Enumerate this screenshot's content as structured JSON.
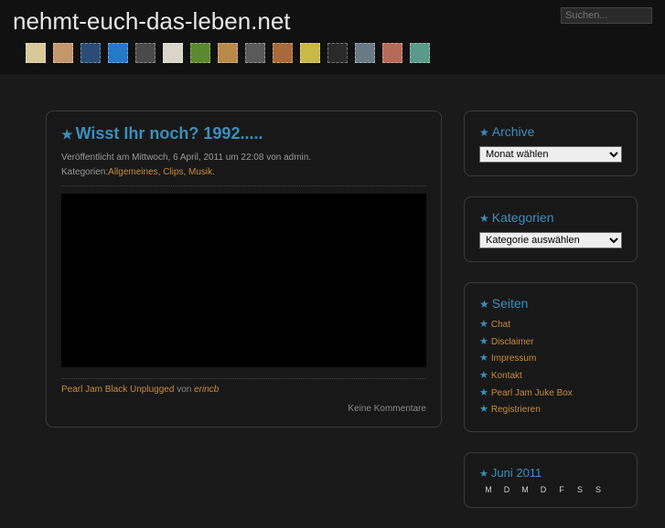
{
  "site": {
    "title": "nehmt-euch-das-leben.net"
  },
  "search": {
    "placeholder": "Suchen..."
  },
  "swatches": [
    "#d9c99a",
    "#c4966b",
    "#2b4d75",
    "#2878c8",
    "#4a4a4a",
    "#d9d5c8",
    "#5a8a2d",
    "#b88a4a",
    "#5a5a5a",
    "#a86a3a",
    "#c9b84a",
    "#2a2a2a",
    "#6a7a85",
    "#b86a5a",
    "#5a9a8a"
  ],
  "post": {
    "title": "Wisst Ihr noch? 1992.....",
    "meta_line": "Veröffentlicht am Mittwoch, 6 April, 2011 um 22:08 von admin.",
    "cat_label": "Kategorien:",
    "cats": [
      "Allgemeines",
      "Clips",
      "Musik"
    ],
    "video_caption_title": "Pearl Jam Black Unplugged",
    "video_caption_by": "von",
    "video_caption_author": "erincb",
    "comments": "Keine Kommentare"
  },
  "widgets": {
    "archive": {
      "title": "Archive",
      "select": "Monat wählen"
    },
    "categories": {
      "title": "Kategorien",
      "select": "Kategorie auswählen"
    },
    "pages": {
      "title": "Seiten",
      "items": [
        "Chat",
        "Disclaimer",
        "Impressum",
        "Kontakt",
        "Pearl Jam Juke Box",
        "Registrieren"
      ]
    },
    "calendar": {
      "title": "Juni 2011",
      "days": [
        "M",
        "D",
        "M",
        "D",
        "F",
        "S",
        "S"
      ]
    }
  }
}
